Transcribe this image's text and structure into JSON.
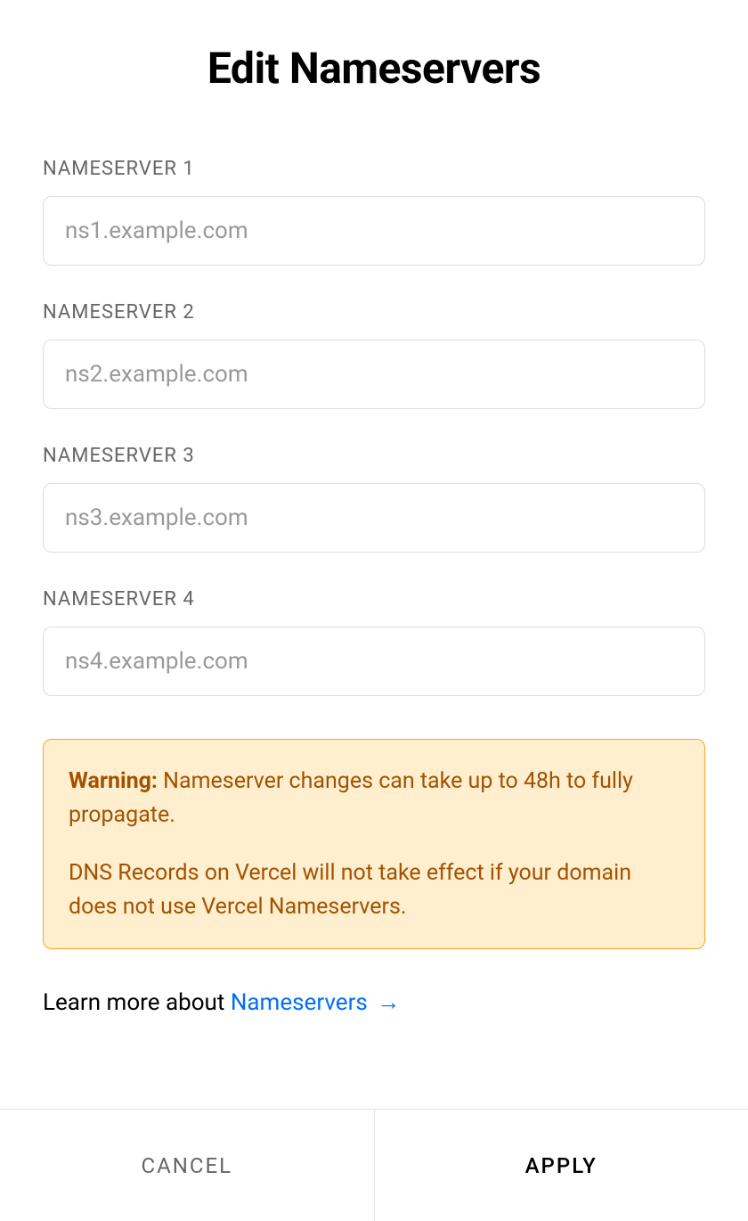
{
  "title": "Edit Nameservers",
  "fields": [
    {
      "label": "NAMESERVER 1",
      "placeholder": "ns1.example.com"
    },
    {
      "label": "NAMESERVER 2",
      "placeholder": "ns2.example.com"
    },
    {
      "label": "NAMESERVER 3",
      "placeholder": "ns3.example.com"
    },
    {
      "label": "NAMESERVER 4",
      "placeholder": "ns4.example.com"
    }
  ],
  "warning": {
    "label": "Warning:",
    "text1": " Nameserver changes can take up to 48h to fully propagate.",
    "text2": "DNS Records on Vercel will not take effect if your domain does not use Vercel Nameservers."
  },
  "learnMore": {
    "prefix": "Learn more about ",
    "linkText": "Nameservers",
    "arrow": "→"
  },
  "buttons": {
    "cancel": "CANCEL",
    "apply": "APPLY"
  }
}
